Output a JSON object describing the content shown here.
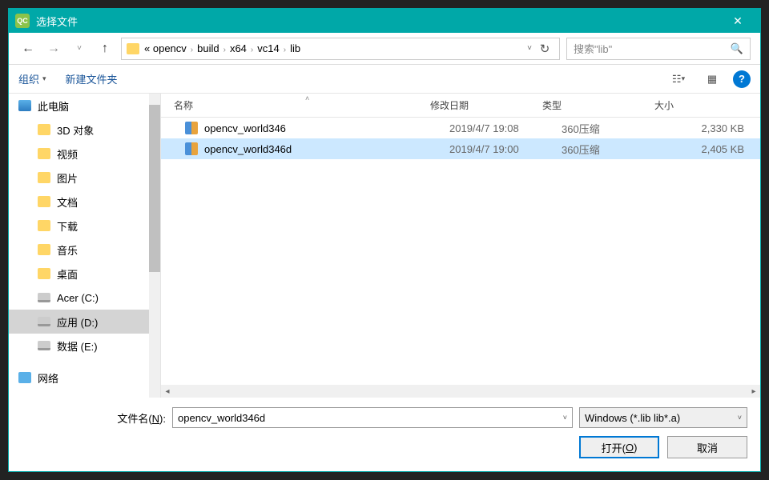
{
  "titlebar": {
    "icon": "QC",
    "title": "选择文件"
  },
  "nav": {
    "breadcrumb": [
      "opencv",
      "build",
      "x64",
      "vc14",
      "lib"
    ],
    "prefix": "«",
    "search_placeholder": "搜索\"lib\""
  },
  "toolbar": {
    "organize": "组织",
    "newfolder": "新建文件夹"
  },
  "sidebar": {
    "root": "此电脑",
    "items": [
      "3D 对象",
      "视频",
      "图片",
      "文档",
      "下载",
      "音乐",
      "桌面",
      "Acer (C:)",
      "应用 (D:)",
      "数据 (E:)"
    ],
    "selected": "应用 (D:)",
    "network": "网络"
  },
  "columns": {
    "name": "名称",
    "date": "修改日期",
    "type": "类型",
    "size": "大小"
  },
  "files": [
    {
      "name": "opencv_world346",
      "date": "2019/4/7 19:08",
      "type": "360压缩",
      "size": "2,330 KB",
      "selected": false
    },
    {
      "name": "opencv_world346d",
      "date": "2019/4/7 19:00",
      "type": "360压缩",
      "size": "2,405 KB",
      "selected": true
    }
  ],
  "footer": {
    "filename_label": "文件名(N):",
    "filename_value": "opencv_world346d",
    "filter": "Windows (*.lib lib*.a)",
    "open": "打开(O)",
    "cancel": "取消"
  }
}
